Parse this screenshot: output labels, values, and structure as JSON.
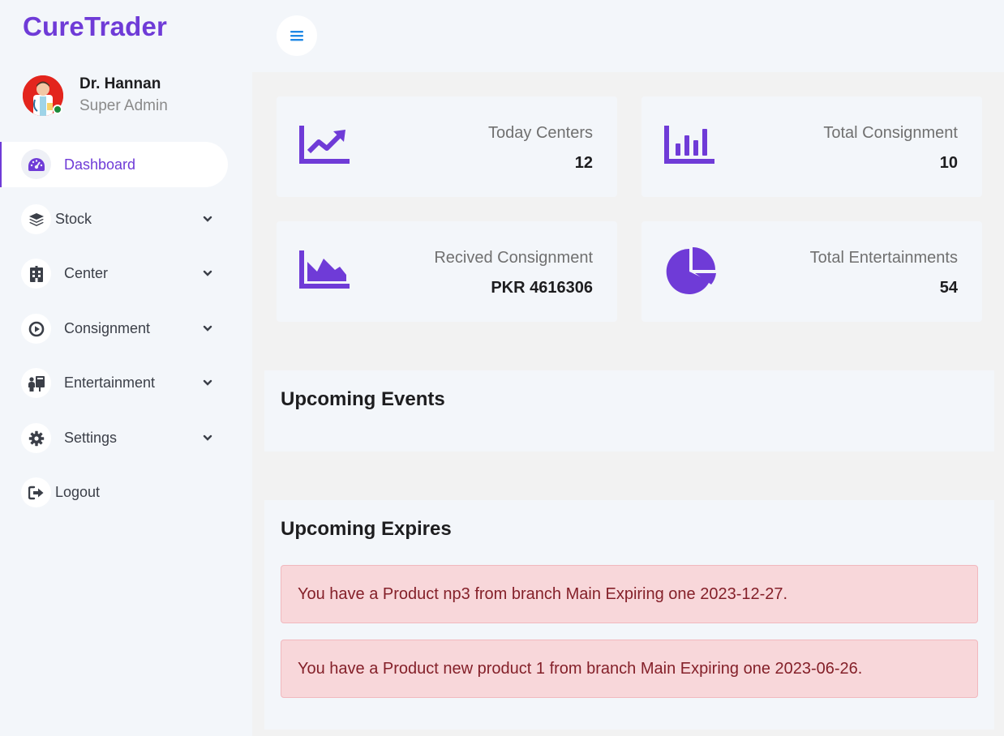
{
  "brand": {
    "name": "CureTrader"
  },
  "profile": {
    "name": "Dr. Hannan",
    "role": "Super Admin",
    "status": "online"
  },
  "colors": {
    "accent": "#6f3bd7",
    "sidebar_bg": "#f3f6fa",
    "alert_bg": "#f8d7da",
    "alert_text": "#842029",
    "online": "#1b8a3a"
  },
  "sidebar": {
    "items": [
      {
        "label": "Dashboard",
        "icon": "gauge-icon",
        "active": true,
        "expandable": false
      },
      {
        "label": "Stock",
        "icon": "layers-icon",
        "active": false,
        "expandable": true
      },
      {
        "label": "Center",
        "icon": "building-icon",
        "active": false,
        "expandable": true
      },
      {
        "label": "Consignment",
        "icon": "play-circle-icon",
        "active": false,
        "expandable": true
      },
      {
        "label": "Entertainment",
        "icon": "people-icon",
        "active": false,
        "expandable": true
      },
      {
        "label": "Settings",
        "icon": "gear-icon",
        "active": false,
        "expandable": true
      },
      {
        "label": "Logout",
        "icon": "logout-icon",
        "active": false,
        "expandable": false
      }
    ]
  },
  "topbar": {
    "menu_icon": "hamburger-icon"
  },
  "stats": [
    {
      "label": "Today Centers",
      "value": "12",
      "icon": "chart-line-icon"
    },
    {
      "label": "Total Consignment",
      "value": "10",
      "icon": "chart-bar-icon"
    },
    {
      "label": "Recived Consignment",
      "value": "PKR 4616306",
      "icon": "chart-area-icon"
    },
    {
      "label": "Total Entertainments",
      "value": "54",
      "icon": "chart-pie-icon"
    }
  ],
  "events": {
    "title": "Upcoming Events"
  },
  "expires": {
    "title": "Upcoming Expires",
    "alerts": [
      "You have a Product np3 from branch Main Expiring one 2023-12-27.",
      "You have a Product new product 1 from branch Main Expiring one 2023-06-26."
    ]
  }
}
